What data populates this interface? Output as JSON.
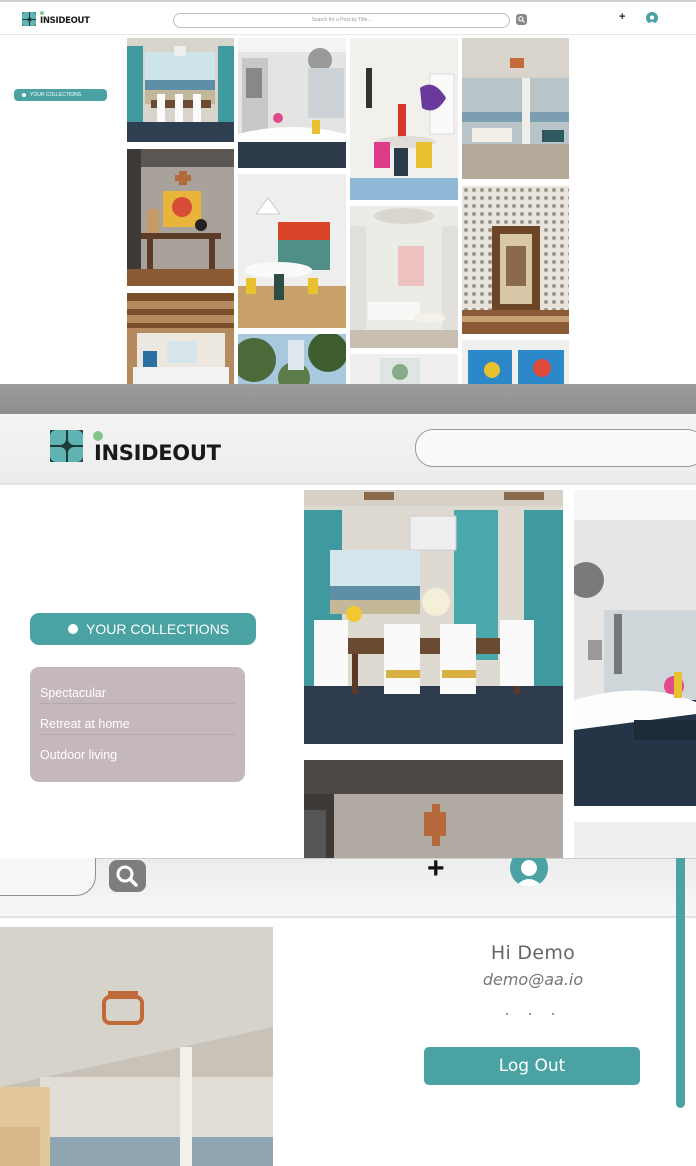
{
  "brand": {
    "name": "INSIDEOUT",
    "accent": "#4aa3a2",
    "logo_dot": "#7fc88a"
  },
  "header": {
    "search_placeholder": "Search for a Post by Title...",
    "add_label": "+",
    "search_icon": "search-icon",
    "avatar_icon": "user-avatar-icon"
  },
  "sidebar": {
    "collections_button": "YOUR COLLECTIONS",
    "collections": [
      "Spectacular",
      "Retreat at home",
      "Outdoor living"
    ]
  },
  "user_menu": {
    "greeting": "Hi Demo",
    "email": "demo@aa.io",
    "more": "· · ·",
    "logout_label": "Log Out"
  },
  "gallery": {
    "images": [
      "dining-room-ocean-view",
      "bathroom-chandelier",
      "colorful-dining-chairs",
      "terrace-sea-view",
      "console-table-art",
      "modern-kitchen",
      "white-living-room",
      "patterned-wallpaper-doorway",
      "wood-beam-living-room",
      "trees-view",
      "white-interior",
      "colorful-art"
    ]
  }
}
